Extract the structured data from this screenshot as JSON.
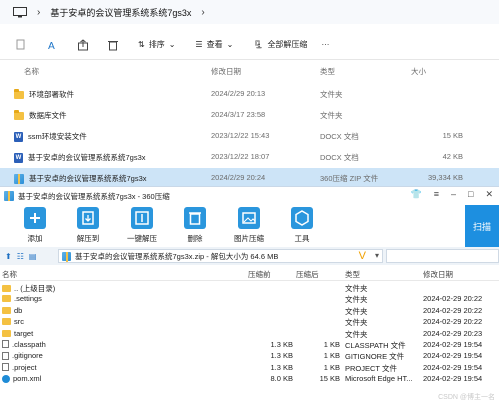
{
  "explorer": {
    "breadcrumb": "基于安卓的会议管理系统系统7gs3x",
    "toolbar": {
      "sort": "排序",
      "view": "查看",
      "extract_all": "全部解压缩",
      "more": "···"
    },
    "columns": {
      "name": "名称",
      "date": "修改日期",
      "type": "类型",
      "size": "大小"
    },
    "rows": [
      {
        "icon": "folder-icon",
        "name": "环境部署软件",
        "date": "2024/2/29 20:13",
        "type": "文件夹",
        "size": ""
      },
      {
        "icon": "folder-icon",
        "name": "数据库文件",
        "date": "2024/3/17 23:58",
        "type": "文件夹",
        "size": ""
      },
      {
        "icon": "docx-icon",
        "name": "ssm环境安装文件",
        "date": "2023/12/22 15:43",
        "type": "DOCX 文档",
        "size": "15 KB"
      },
      {
        "icon": "docx-icon",
        "name": "基于安卓的会议管理系统系统7gs3x",
        "date": "2023/12/22 18:07",
        "type": "DOCX 文档",
        "size": "42 KB"
      },
      {
        "icon": "zip-icon",
        "name": "基于安卓的会议管理系统系统7gs3x",
        "date": "2024/2/29 20:24",
        "type": "360压缩 ZIP 文件",
        "size": "39,334 KB"
      }
    ]
  },
  "zip": {
    "title": "基于安卓的会议管理系统系统7gs3x - 360压缩",
    "toolbar": [
      "添加",
      "解压到",
      "一键解压",
      "删除",
      "图片压缩",
      "工具"
    ],
    "side_panel": "扫描",
    "path_text": "基于安卓的会议管理系统系统7gs3x.zip - 解包大小为 64.6 MB",
    "columns": {
      "name": "名称",
      "compressed": "压缩前",
      "compressed_after": "压缩后",
      "type": "类型",
      "date": "修改日期"
    },
    "rows": [
      {
        "icon": "folder",
        "name": ".. (上级目录)",
        "before": "",
        "after": "",
        "type": "文件夹",
        "date": ""
      },
      {
        "icon": "folder",
        "name": ".settings",
        "before": "",
        "after": "",
        "type": "文件夹",
        "date": "2024-02-29 20:22"
      },
      {
        "icon": "folder",
        "name": "db",
        "before": "",
        "after": "",
        "type": "文件夹",
        "date": "2024-02-29 20:22"
      },
      {
        "icon": "folder",
        "name": "src",
        "before": "",
        "after": "",
        "type": "文件夹",
        "date": "2024-02-29 20:22"
      },
      {
        "icon": "folder",
        "name": "target",
        "before": "",
        "after": "",
        "type": "文件夹",
        "date": "2024-02-29 20:23"
      },
      {
        "icon": "file",
        "name": ".classpath",
        "before": "1.3 KB",
        "after": "1 KB",
        "type": "CLASSPATH 文件",
        "date": "2024-02-29 19:54"
      },
      {
        "icon": "file",
        "name": ".gitignore",
        "before": "1.3 KB",
        "after": "1 KB",
        "type": "GITIGNORE 文件",
        "date": "2024-02-29 19:54"
      },
      {
        "icon": "file",
        "name": ".project",
        "before": "1.3 KB",
        "after": "1 KB",
        "type": "PROJECT 文件",
        "date": "2024-02-29 19:54"
      },
      {
        "icon": "edge",
        "name": "pom.xml",
        "before": "8.0 KB",
        "after": "15 KB",
        "type": "Microsoft Edge HT...",
        "date": "2024-02-29 19:54"
      }
    ],
    "watermark": "CSDN @博主一名"
  }
}
